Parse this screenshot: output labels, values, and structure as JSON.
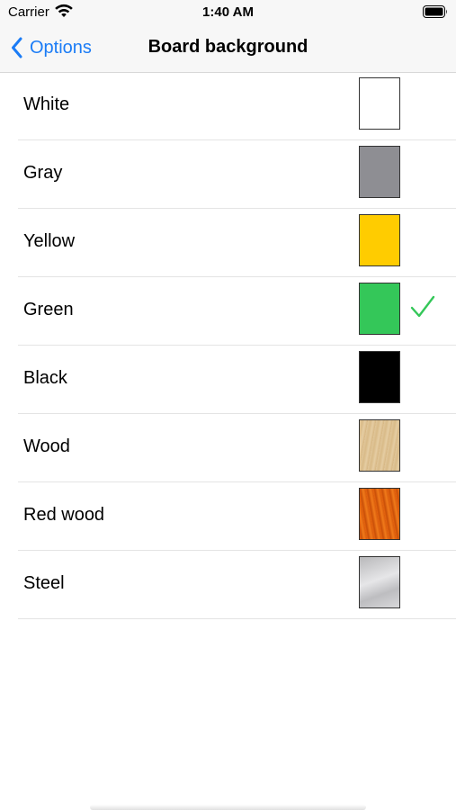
{
  "status_bar": {
    "carrier": "Carrier",
    "time": "1:40 AM"
  },
  "nav": {
    "back_label": "Options",
    "title": "Board background"
  },
  "accent_color": "#1b7cf6",
  "check_color": "#34c759",
  "options": [
    {
      "label": "White",
      "swatch": "#ffffff",
      "selected": false
    },
    {
      "label": "Gray",
      "swatch": "#8e8e93",
      "selected": false
    },
    {
      "label": "Yellow",
      "swatch": "#ffcc00",
      "selected": false
    },
    {
      "label": "Green",
      "swatch": "#34c759",
      "selected": true
    },
    {
      "label": "Black",
      "swatch": "#000000",
      "selected": false
    },
    {
      "label": "Wood",
      "swatch": "#dcc093",
      "selected": false
    },
    {
      "label": "Red wood",
      "swatch": "#e2620f",
      "selected": false
    },
    {
      "label": "Steel",
      "swatch": "#c9c9cb",
      "selected": false
    }
  ]
}
